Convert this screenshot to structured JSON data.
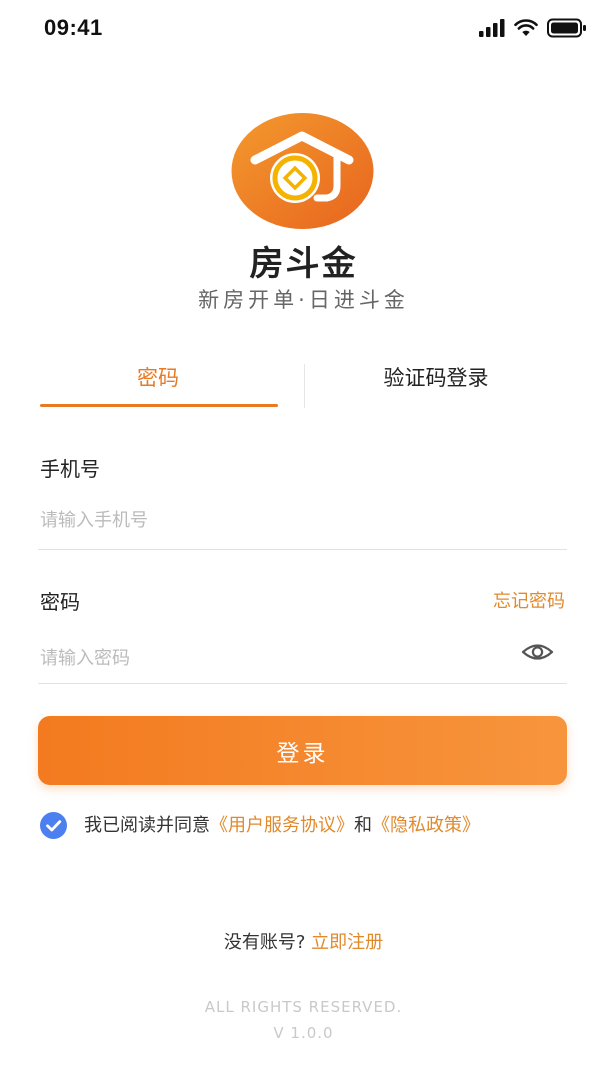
{
  "status_bar": {
    "time": "09:41"
  },
  "app": {
    "name": "房斗金",
    "slogan": "新房开单·日进斗金"
  },
  "tabs": [
    {
      "label": "密码",
      "active": true
    },
    {
      "label": "验证码登录",
      "active": false
    }
  ],
  "form": {
    "phone": {
      "label": "手机号",
      "placeholder": "请输入手机号",
      "value": ""
    },
    "password": {
      "label": "密码",
      "placeholder": "请输入密码",
      "value": "",
      "forgot_label": "忘记密码"
    },
    "login_label": "登录"
  },
  "agreement": {
    "checked": true,
    "prefix": "我已阅读并同意",
    "user_agreement": "《用户服务协议》",
    "conjunction": "和",
    "privacy_policy": "《隐私政策》"
  },
  "register": {
    "prompt": "没有账号?",
    "link": "立即注册"
  },
  "footer": {
    "copyright": "ALL RIGHTS RESERVED.",
    "version": "V 1.0.0"
  },
  "icons": [
    "signal-icon",
    "wifi-icon",
    "battery-icon",
    "house-coin-logo",
    "eye-icon",
    "check-icon"
  ],
  "colors": {
    "accent": "#e87a24",
    "button_start": "#f37a1f",
    "button_end": "#f7953d",
    "check": "#4c7ff0"
  }
}
